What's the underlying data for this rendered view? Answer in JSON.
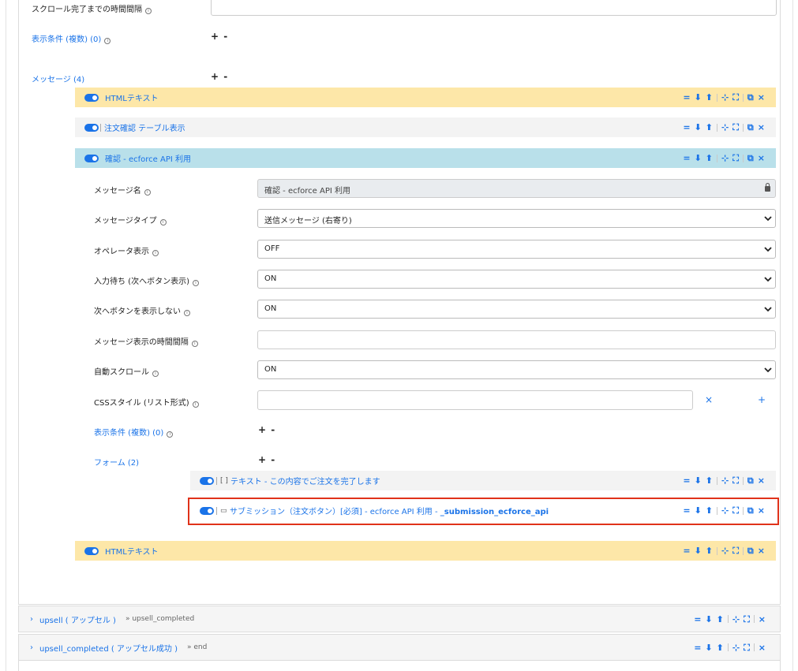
{
  "top": {
    "scroll_interval_label": "スクロール完了までの時間間隔",
    "display_conditions_label": "表示条件 (複数) (0)",
    "messages_label": "メッセージ (4)"
  },
  "messages": [
    {
      "title": "HTMLテキスト",
      "color": "#fde7a8"
    },
    {
      "title": "注文確認 テーブル表示",
      "color": "#f3f3f3"
    },
    {
      "title": "確認 - ecforce API 利用",
      "color": "#b9e0ea"
    },
    {
      "title": "HTMLテキスト",
      "color": "#fde7a8"
    }
  ],
  "form": {
    "message_name_label": "メッセージ名",
    "message_name_value": "確認 - ecforce API 利用",
    "message_type_label": "メッセージタイプ",
    "message_type_value": "送信メッセージ (右寄り)",
    "operator_label": "オペレータ表示",
    "operator_value": "OFF",
    "wait_input_label": "入力待ち (次へボタン表示)",
    "wait_input_value": "ON",
    "hide_next_label": "次へボタンを表示しない",
    "hide_next_value": "ON",
    "msg_interval_label": "メッセージ表示の時間間隔",
    "auto_scroll_label": "自動スクロール",
    "auto_scroll_value": "ON",
    "css_label": "CSSスタイル (リスト形式)",
    "display_conditions_label": "表示条件 (複数) (0)",
    "forms_label": "フォーム (2)"
  },
  "form_items": [
    {
      "icon": "[ ]",
      "title": "テキスト - この内容でご注文を完了します"
    },
    {
      "icon": "▭",
      "title": "サブミッション（注文ボタン）[必須] - ecforce API 利用 - ",
      "title_bold": "_submission_ecforce_api"
    }
  ],
  "sections": [
    {
      "title": "upsell ( アップセル )",
      "next": "» upsell_completed"
    },
    {
      "title": "upsell_completed ( アップセル成功 )",
      "next": "» end"
    }
  ],
  "icons": {
    "info": "ⓘ",
    "plus_minus": "+ -",
    "tool_eq": "=",
    "tool_down": "⬇",
    "tool_up": "⬆",
    "tool_collapse": "⊹",
    "tool_expand": "⛶",
    "tool_copy": "⧉",
    "tool_close": "×",
    "css_clear": "×",
    "css_add": "+",
    "caret": "›"
  }
}
